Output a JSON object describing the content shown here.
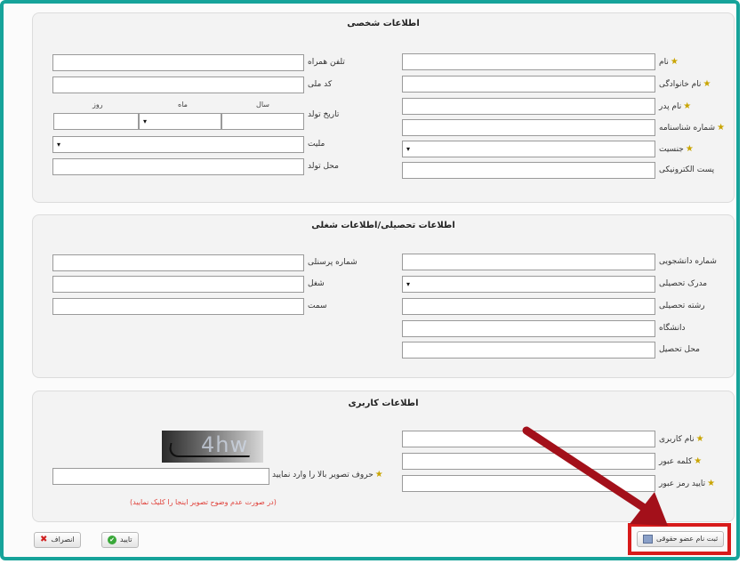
{
  "personal": {
    "title": "اطلاعات شخصی",
    "labels": {
      "first_name": "نام",
      "last_name": "نام خانوادگی",
      "father_name": "نام پدر",
      "id_number": "شماره شناسنامه",
      "gender": "جنسیت",
      "email": "پست الکترونیکی",
      "mobile": "تلفن همراه",
      "national_code": "کد ملی",
      "birth_date": "تاریخ تولد",
      "nationality": "ملیت",
      "birth_place": "محل تولد"
    },
    "date_parts": {
      "year": "سال",
      "month": "ماه",
      "day": "روز"
    }
  },
  "education": {
    "title": "اطلاعات تحصیلی/اطلاعات شغلی",
    "labels": {
      "student_number": "شماره دانشجویی",
      "degree": "مدرک تحصیلی",
      "field_of_study": "رشته تحصیلی",
      "university": "دانشگاه",
      "study_place": "محل تحصیل",
      "personnel_number": "شماره پرسنلی",
      "job": "شغل",
      "position": "سمت"
    }
  },
  "account": {
    "title": "اطلاعات کاربری",
    "labels": {
      "username": "نام کاربری",
      "password": "کلمه عبور",
      "confirm_password": "تایید رمز عبور",
      "captcha_prompt": "حروف تصویر بالا را وارد نمایید"
    },
    "captcha_hint": "(در صورت عدم وضوح تصویر اینجا را کلیک نمایید)",
    "captcha_image_text": "4hw"
  },
  "buttons": {
    "register": "ثبت نام عضو حقوقی",
    "confirm": "تایید",
    "cancel": "انصراف"
  },
  "select_arrow": "▾",
  "colors": {
    "frame_border": "#16a39a",
    "required_star": "#c9a400",
    "hint_text": "#e0413a",
    "highlight": "#d81b1b",
    "arrow": "#a3101a"
  }
}
